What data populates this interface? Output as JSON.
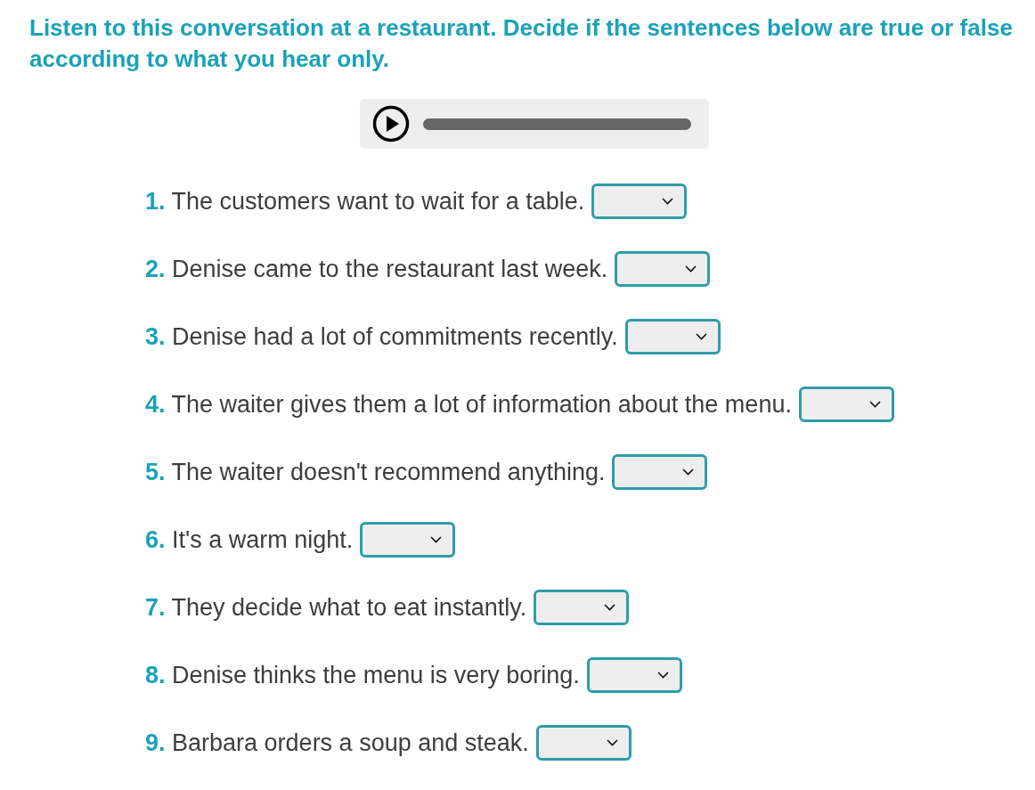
{
  "instructions": "Listen to this conversation at a restaurant. Decide if the sentences below are true or false according to what you hear only.",
  "questions": [
    {
      "number": "1.",
      "text": "The customers want to wait for a table."
    },
    {
      "number": "2.",
      "text": "Denise came to the restaurant last week."
    },
    {
      "number": "3.",
      "text": "Denise had a lot of commitments recently."
    },
    {
      "number": "4.",
      "text": "The waiter gives them a lot of information about the menu."
    },
    {
      "number": "5.",
      "text": "The waiter doesn't recommend anything."
    },
    {
      "number": "6.",
      "text": "It's a warm night."
    },
    {
      "number": "7.",
      "text": "They decide what to eat instantly."
    },
    {
      "number": "8.",
      "text": "Denise thinks the menu is very boring."
    },
    {
      "number": "9.",
      "text": "Barbara orders a soup and steak."
    }
  ]
}
